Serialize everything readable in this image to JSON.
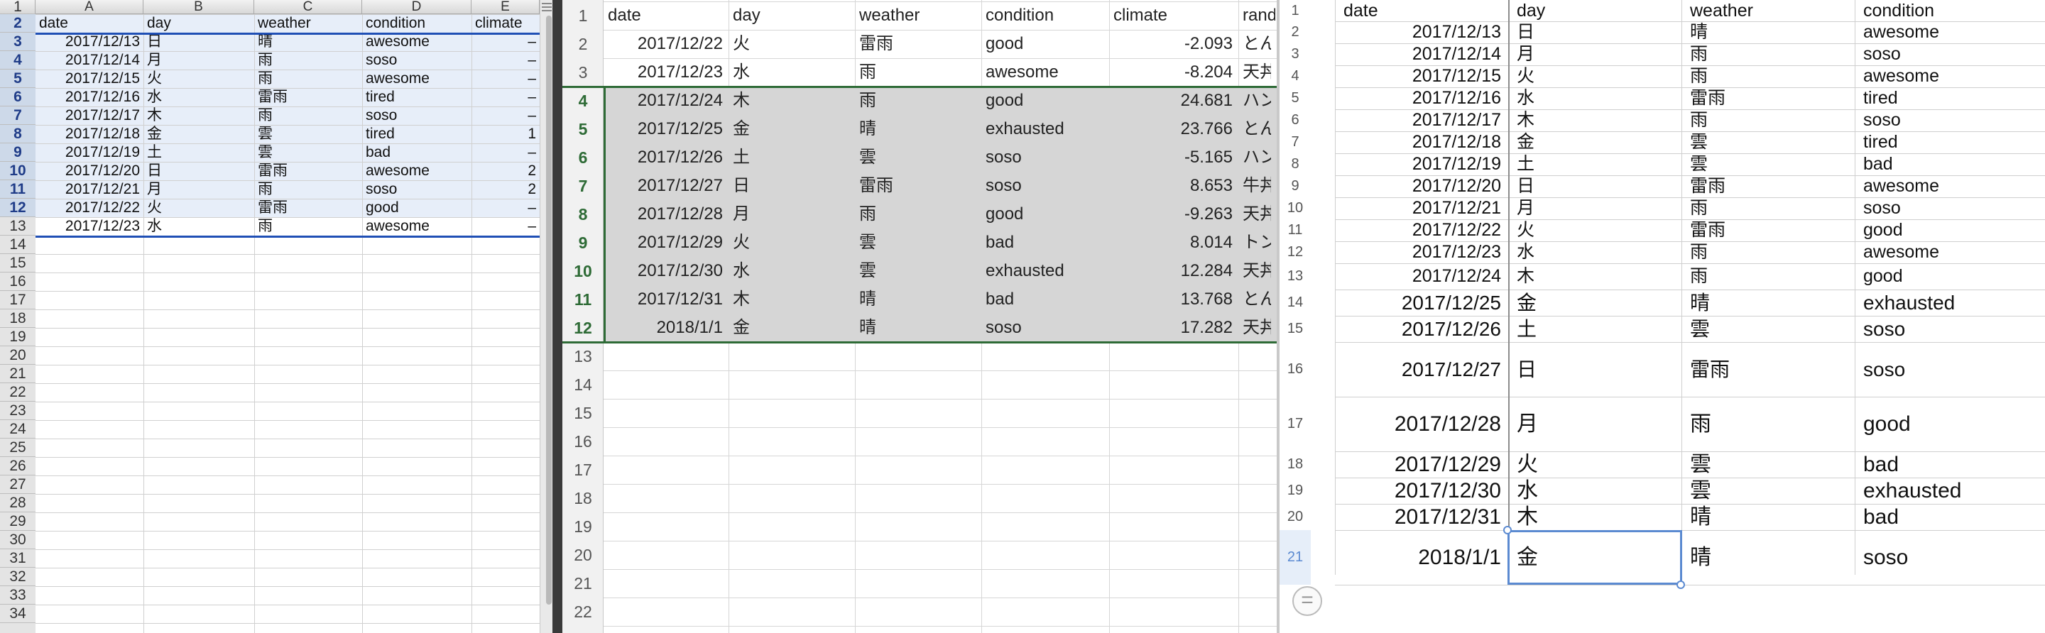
{
  "pane1": {
    "col_letters": [
      "A",
      "B",
      "C",
      "D",
      "E"
    ],
    "header": [
      "date",
      "day",
      "weather",
      "condition",
      "climate"
    ],
    "rows": [
      [
        "2017/12/13",
        "日",
        "晴",
        "awesome",
        "–"
      ],
      [
        "2017/12/14",
        "月",
        "雨",
        "soso",
        "–"
      ],
      [
        "2017/12/15",
        "火",
        "雨",
        "awesome",
        "–"
      ],
      [
        "2017/12/16",
        "水",
        "雷雨",
        "tired",
        "–"
      ],
      [
        "2017/12/17",
        "木",
        "雨",
        "soso",
        "–"
      ],
      [
        "2017/12/18",
        "金",
        "雲",
        "tired",
        "1"
      ],
      [
        "2017/12/19",
        "土",
        "雲",
        "bad",
        "–"
      ],
      [
        "2017/12/20",
        "日",
        "雷雨",
        "awesome",
        "2"
      ],
      [
        "2017/12/21",
        "月",
        "雨",
        "soso",
        "2"
      ],
      [
        "2017/12/22",
        "火",
        "雷雨",
        "good",
        "–"
      ],
      [
        "2017/12/23",
        "水",
        "雨",
        "awesome",
        "–"
      ]
    ],
    "row_numbers": [
      "1",
      "2",
      "3",
      "4",
      "5",
      "6",
      "7",
      "8",
      "9",
      "10",
      "11",
      "12",
      "13",
      "14",
      "15",
      "16",
      "17",
      "18",
      "19",
      "20",
      "21",
      "22",
      "23",
      "24",
      "25",
      "26",
      "27",
      "28",
      "29",
      "30",
      "31",
      "32",
      "33",
      "34"
    ]
  },
  "pane2": {
    "header": [
      "date",
      "day",
      "weather",
      "condition",
      "climate",
      "rand"
    ],
    "rows": [
      [
        "2017/12/22",
        "火",
        "雷雨",
        "good",
        "-2.093",
        "とん"
      ],
      [
        "2017/12/23",
        "水",
        "雨",
        "awesome",
        "-8.204",
        "天丼"
      ],
      [
        "2017/12/24",
        "木",
        "雨",
        "good",
        "24.681",
        "ハン"
      ],
      [
        "2017/12/25",
        "金",
        "晴",
        "exhausted",
        "23.766",
        "とん"
      ],
      [
        "2017/12/26",
        "土",
        "雲",
        "soso",
        "-5.165",
        "ハン"
      ],
      [
        "2017/12/27",
        "日",
        "雷雨",
        "soso",
        "8.653",
        "牛丼"
      ],
      [
        "2017/12/28",
        "月",
        "雨",
        "good",
        "-9.263",
        "天丼"
      ],
      [
        "2017/12/29",
        "火",
        "雲",
        "bad",
        "8.014",
        "トン"
      ],
      [
        "2017/12/30",
        "水",
        "雲",
        "exhausted",
        "12.284",
        "天丼"
      ],
      [
        "2017/12/31",
        "木",
        "晴",
        "bad",
        "13.768",
        "とん"
      ],
      [
        "2018/1/1",
        "金",
        "晴",
        "soso",
        "17.282",
        "天丼"
      ]
    ],
    "row_numbers": [
      "1",
      "2",
      "3",
      "4",
      "5",
      "6",
      "7",
      "8",
      "9",
      "10",
      "11",
      "12",
      "13",
      "14",
      "15",
      "16",
      "17",
      "18",
      "19",
      "20",
      "21",
      "22"
    ]
  },
  "pane3": {
    "header": [
      "date",
      "day",
      "weather",
      "condition"
    ],
    "rows": [
      [
        "2017/12/13",
        "日",
        "晴",
        "awesome"
      ],
      [
        "2017/12/14",
        "月",
        "雨",
        "soso"
      ],
      [
        "2017/12/15",
        "火",
        "雨",
        "awesome"
      ],
      [
        "2017/12/16",
        "水",
        "雷雨",
        "tired"
      ],
      [
        "2017/12/17",
        "木",
        "雨",
        "soso"
      ],
      [
        "2017/12/18",
        "金",
        "雲",
        "tired"
      ],
      [
        "2017/12/19",
        "土",
        "雲",
        "bad"
      ],
      [
        "2017/12/20",
        "日",
        "雷雨",
        "awesome"
      ],
      [
        "2017/12/21",
        "月",
        "雨",
        "soso"
      ],
      [
        "2017/12/22",
        "火",
        "雷雨",
        "good"
      ],
      [
        "2017/12/23",
        "水",
        "雨",
        "awesome"
      ],
      [
        "2017/12/24",
        "木",
        "雨",
        "good"
      ],
      [
        "2017/12/25",
        "金",
        "晴",
        "exhausted"
      ],
      [
        "2017/12/26",
        "土",
        "雲",
        "soso"
      ],
      [
        "2017/12/27",
        "日",
        "雷雨",
        "soso"
      ],
      [
        "2017/12/28",
        "月",
        "雨",
        "good"
      ],
      [
        "2017/12/29",
        "火",
        "雲",
        "bad"
      ],
      [
        "2017/12/30",
        "水",
        "雲",
        "exhausted"
      ],
      [
        "2017/12/31",
        "木",
        "晴",
        "bad"
      ],
      [
        "2018/1/1",
        "金",
        "晴",
        "soso"
      ]
    ],
    "row_numbers": [
      "1",
      "2",
      "3",
      "4",
      "5",
      "6",
      "7",
      "8",
      "9",
      "10",
      "11",
      "12",
      "13",
      "14",
      "15",
      "16",
      "17",
      "18",
      "19",
      "20",
      "21"
    ],
    "add_sheet_glyph": "="
  },
  "colors": {
    "selection_blue": "#1f4fb5",
    "selection_green": "#2e6b36",
    "pane2_selected_fill": "#d6d6d6",
    "pane3_active": "#5b8ad1"
  }
}
